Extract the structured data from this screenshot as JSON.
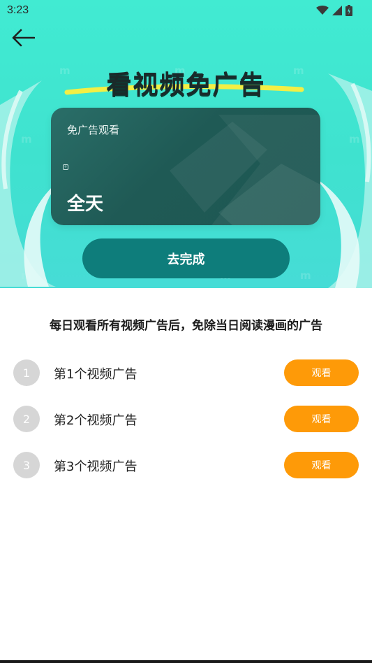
{
  "status_bar": {
    "time": "3:23"
  },
  "hero": {
    "title": "看视频免广告",
    "watermark": "m",
    "card": {
      "label": "免广告观看",
      "value": "全天"
    },
    "cta_label": "去完成"
  },
  "description": "每日观看所有视频广告后，免除当日阅读漫画的广告",
  "tasks": [
    {
      "number": "1",
      "label": "第1个视频广告",
      "button": "观看"
    },
    {
      "number": "2",
      "label": "第2个视频广告",
      "button": "观看"
    },
    {
      "number": "3",
      "label": "第3个视频广告",
      "button": "观看"
    }
  ],
  "colors": {
    "hero_bg": "#41ebd2",
    "card_bg": "#1f5a55",
    "cta_bg": "#0e7d7b",
    "watch_button": "#fe9a08",
    "number_circle": "#d6d6d6"
  },
  "icons": [
    "wifi-icon",
    "cell-signal-icon",
    "battery-icon",
    "back-arrow-icon"
  ]
}
